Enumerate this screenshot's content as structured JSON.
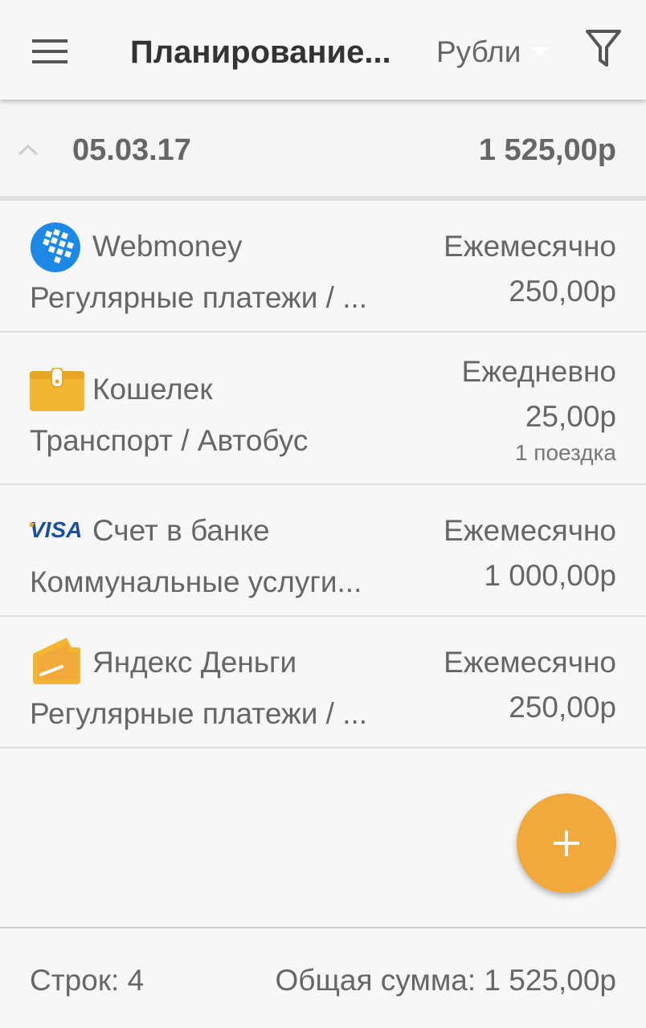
{
  "appbar": {
    "title": "Планирование...",
    "currency": "Рубли",
    "menu_icon": "hamburger-menu-icon",
    "filter_icon": "filter-icon"
  },
  "group": {
    "date": "05.03.17",
    "total": "1 525,00р",
    "collapse_icon": "chevron-up-icon"
  },
  "items": [
    {
      "icon": "webmoney-icon",
      "account": "Webmoney",
      "category": "Регулярные платежи / ...",
      "period": "Ежемесячно",
      "amount": "250,00р",
      "note": ""
    },
    {
      "icon": "wallet-icon",
      "account": "Кошелек",
      "category": "Транспорт / Автобус",
      "period": "Ежедневно",
      "amount": "25,00р",
      "note": "1 поездка"
    },
    {
      "icon": "visa-icon",
      "account": "Счет в банке",
      "category": "Коммунальные услуги...",
      "period": "Ежемесячно",
      "amount": "1 000,00р",
      "note": ""
    },
    {
      "icon": "yandex-money-icon",
      "account": "Яндекс Деньги",
      "category": "Регулярные платежи / ...",
      "period": "Ежемесячно",
      "amount": "250,00р",
      "note": ""
    }
  ],
  "fab": {
    "icon": "plus-icon"
  },
  "footer": {
    "rows_label": "Строк: 4",
    "total_label": "Общая сумма: 1 525,00р"
  },
  "colors": {
    "accent": "#f2a93b",
    "background": "#f7f7f7",
    "webmoney": "#1e88e5",
    "visa_blue": "#1a4fa0",
    "visa_gold": "#f5a623",
    "wallet": "#f2b632"
  }
}
